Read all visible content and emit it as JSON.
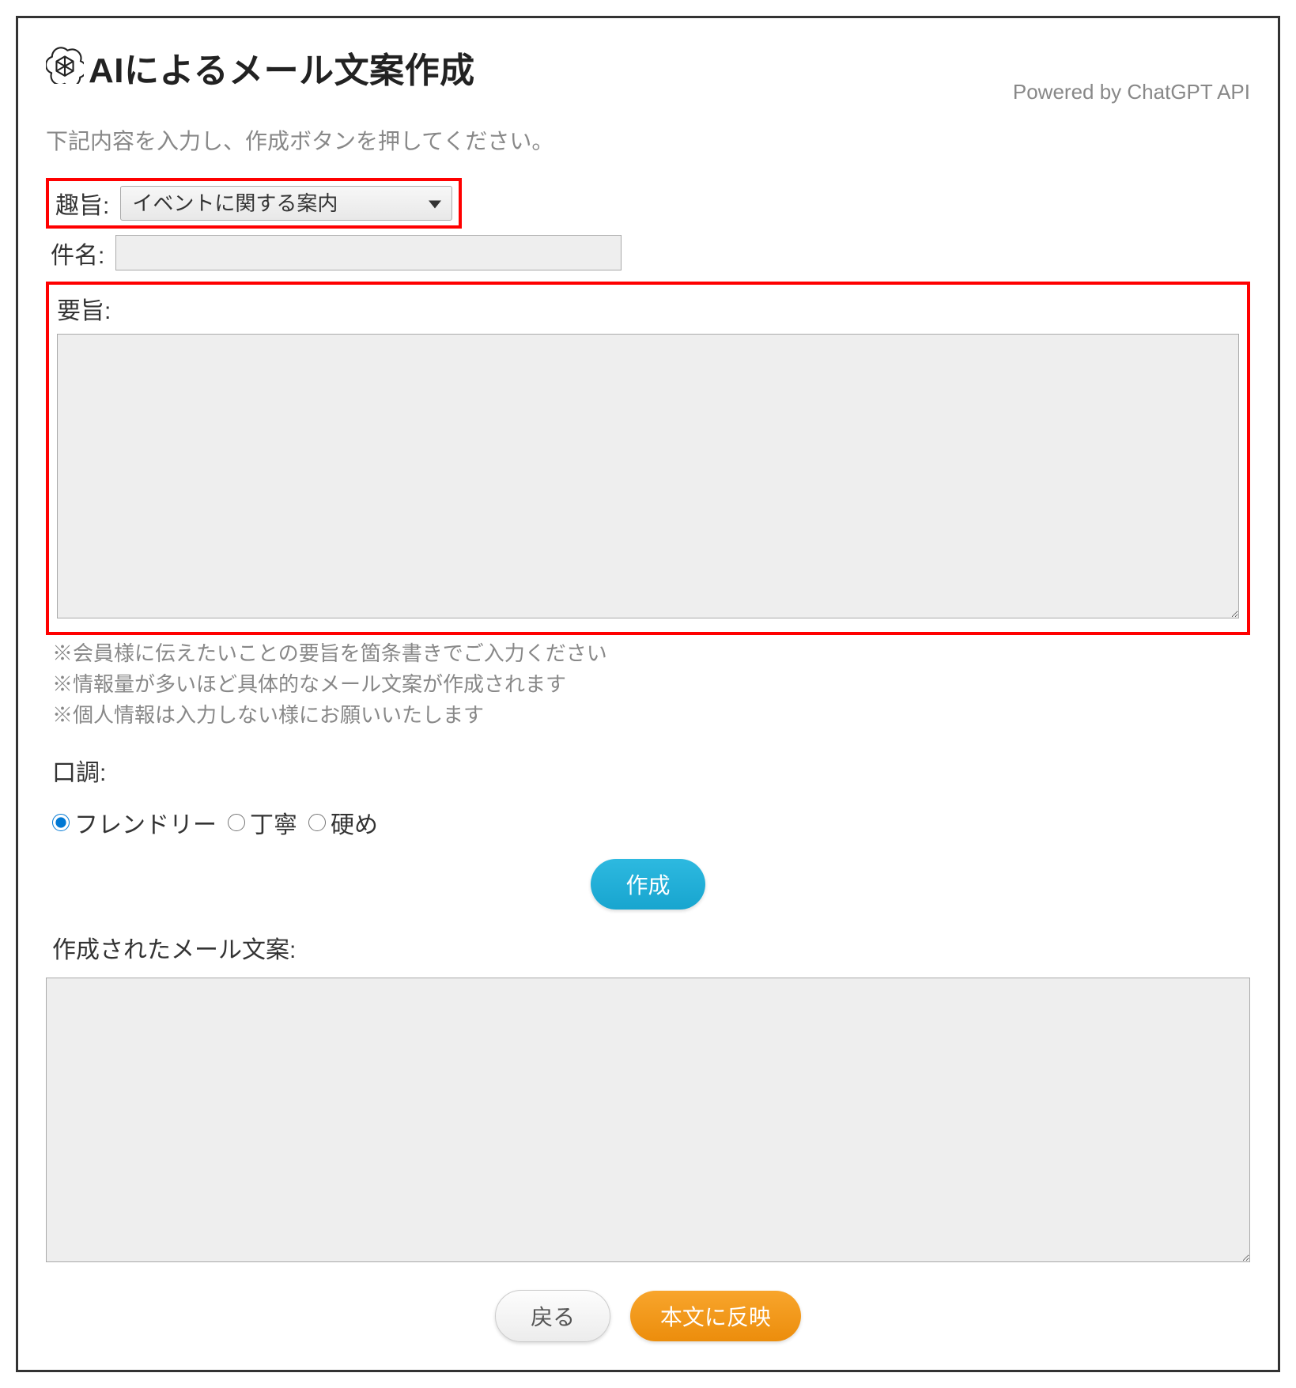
{
  "header": {
    "title": "AIによるメール文案作成",
    "powered_by": "Powered by ChatGPT API"
  },
  "instruction": "下記内容を入力し、作成ボタンを押してください。",
  "purpose": {
    "label": "趣旨:",
    "selected": "イベントに関する案内"
  },
  "subject": {
    "label": "件名:",
    "value": ""
  },
  "summary": {
    "label": "要旨:",
    "value": "",
    "hints": [
      "※会員様に伝えたいことの要旨を箇条書きでご入力ください",
      "※情報量が多いほど具体的なメール文案が作成されます",
      "※個人情報は入力しない様にお願いいたします"
    ]
  },
  "tone": {
    "label": "口調:",
    "options": [
      {
        "value": "friendly",
        "label": "フレンドリー",
        "checked": true
      },
      {
        "value": "polite",
        "label": "丁寧",
        "checked": false
      },
      {
        "value": "formal",
        "label": "硬め",
        "checked": false
      }
    ]
  },
  "buttons": {
    "create": "作成",
    "back": "戻る",
    "apply": "本文に反映"
  },
  "output": {
    "label": "作成されたメール文案:",
    "value": ""
  }
}
